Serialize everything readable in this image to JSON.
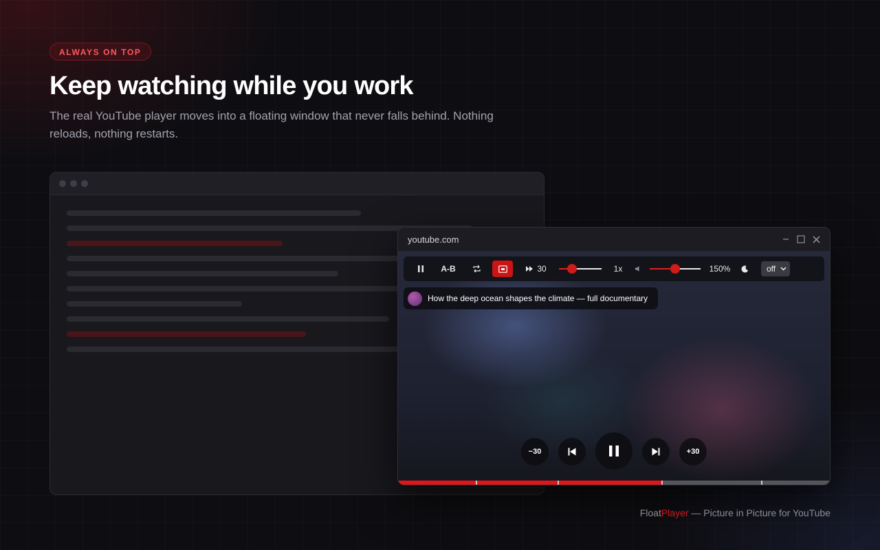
{
  "hero": {
    "badge": "ALWAYS ON TOP",
    "title": "Keep watching while you work",
    "subtitle": "The real YouTube player moves into a floating window that never falls behind. Nothing reloads, nothing restarts."
  },
  "player": {
    "host": "youtube.com",
    "toolbar": {
      "ab_label": "A-B",
      "skip_label": "30",
      "speed_label": "1x",
      "volume_label": "150%",
      "speed_level": 0.3,
      "volume_level": 0.5,
      "select_value": "off"
    },
    "now_playing": {
      "title": "How the deep ocean shapes the climate — full documentary"
    },
    "controls": {
      "back_label": "−30",
      "forward_label": "+30"
    },
    "progress": 0.615,
    "chapter_marks": [
      0.18,
      0.37,
      0.61,
      0.84
    ]
  },
  "footer": {
    "brand_first": "Float",
    "brand_second": "Player",
    "tagline": " — Picture in Picture for YouTube"
  },
  "colors": {
    "accent": "#cc1414",
    "background": "#0e0e12",
    "badge_text": "#ff5a5f"
  }
}
